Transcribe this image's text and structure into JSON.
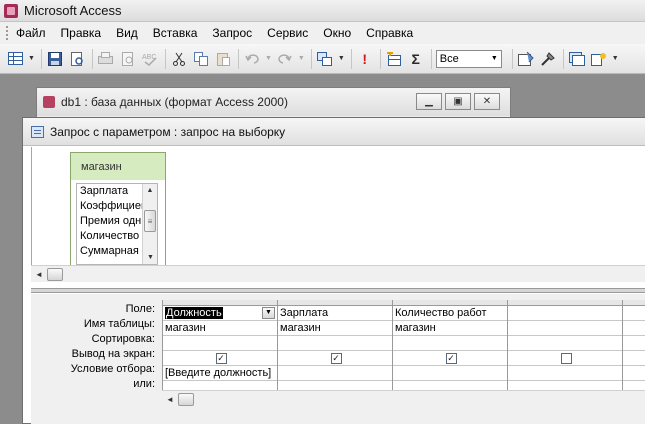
{
  "window": {
    "title": "Microsoft Access"
  },
  "menu": [
    "Файл",
    "Правка",
    "Вид",
    "Вставка",
    "Запрос",
    "Сервис",
    "Окно",
    "Справка"
  ],
  "toolbar": {
    "view_combo": "Все",
    "icons": [
      "grid-view-icon",
      "save-icon",
      "file-search-icon",
      "print-icon",
      "print-preview-icon",
      "spelling-icon",
      "cut-icon",
      "copy-icon",
      "paste-icon",
      "undo-icon",
      "redo-icon",
      "query-type-icon",
      "run-icon",
      "show-table-icon",
      "totals-icon",
      "properties-icon",
      "build-icon",
      "database-window-icon",
      "new-object-icon"
    ],
    "glyphs": {
      "run": "!",
      "totals": "Σ"
    }
  },
  "db_window": {
    "title": "db1 : база данных (формат Access 2000)"
  },
  "query_window": {
    "title": "Запрос с параметром : запрос на выборку",
    "table": {
      "name": "магазин",
      "fields": [
        "Зарплата",
        "Коэффициент",
        "Премия одн",
        "Количество",
        "Суммарная"
      ]
    },
    "row_labels": [
      "Поле:",
      "Имя таблицы:",
      "Сортировка:",
      "Вывод на экран:",
      "Условие отбора:",
      "или:"
    ],
    "columns": [
      {
        "field": "Должность",
        "table": "магазин",
        "sort": "",
        "show": true,
        "criteria": "[Введите должность]",
        "or": ""
      },
      {
        "field": "Зарплата",
        "table": "магазин",
        "sort": "",
        "show": true,
        "criteria": "",
        "or": ""
      },
      {
        "field": "Количество работ",
        "table": "магазин",
        "sort": "",
        "show": true,
        "criteria": "",
        "or": ""
      },
      {
        "field": "",
        "table": "",
        "sort": "",
        "show": false,
        "criteria": "",
        "or": ""
      }
    ]
  }
}
